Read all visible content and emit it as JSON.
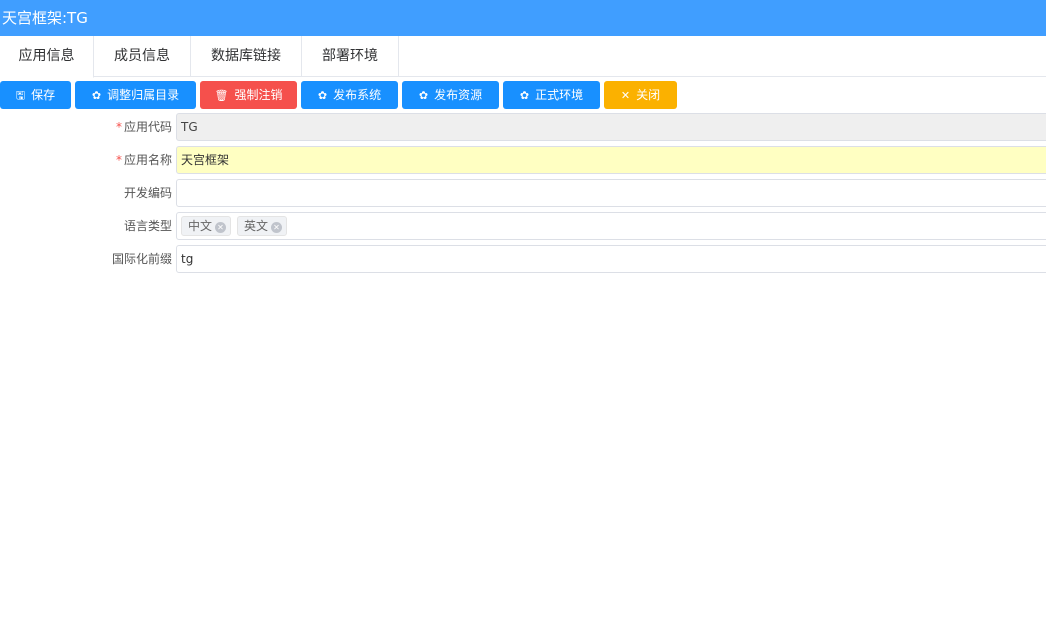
{
  "window": {
    "title": "天宫框架:TG"
  },
  "tabs": [
    {
      "label": "应用信息"
    },
    {
      "label": "成员信息"
    },
    {
      "label": "数据库链接"
    },
    {
      "label": "部署环境"
    }
  ],
  "toolbar": {
    "save": {
      "label": "保存",
      "icon": "save-icon"
    },
    "adjust_dir": {
      "label": "调整归属目录",
      "icon": "gear-icon"
    },
    "force_cancel": {
      "label": "强制注销",
      "icon": "trash-icon"
    },
    "publish_system": {
      "label": "发布系统",
      "icon": "gear-icon"
    },
    "publish_resource": {
      "label": "发布资源",
      "icon": "gear-icon"
    },
    "prod_env": {
      "label": "正式环境",
      "icon": "gear-icon"
    },
    "close": {
      "label": "关闭",
      "icon": "close-icon"
    }
  },
  "form": {
    "app_code": {
      "label": "应用代码",
      "required": "*",
      "value": "TG"
    },
    "app_name": {
      "label": "应用名称",
      "required": "*",
      "value": "天宫框架"
    },
    "dev_code": {
      "label": "开发编码",
      "value": ""
    },
    "language": {
      "label": "语言类型",
      "tags": [
        "中文",
        "英文"
      ]
    },
    "i18n_prefix": {
      "label": "国际化前缀",
      "value": "tg"
    }
  },
  "colors": {
    "primary": "#409eff",
    "button_blue": "#1890ff",
    "button_red": "#f5504c",
    "button_orange": "#fbb100",
    "highlight_field": "#ffffc2"
  }
}
